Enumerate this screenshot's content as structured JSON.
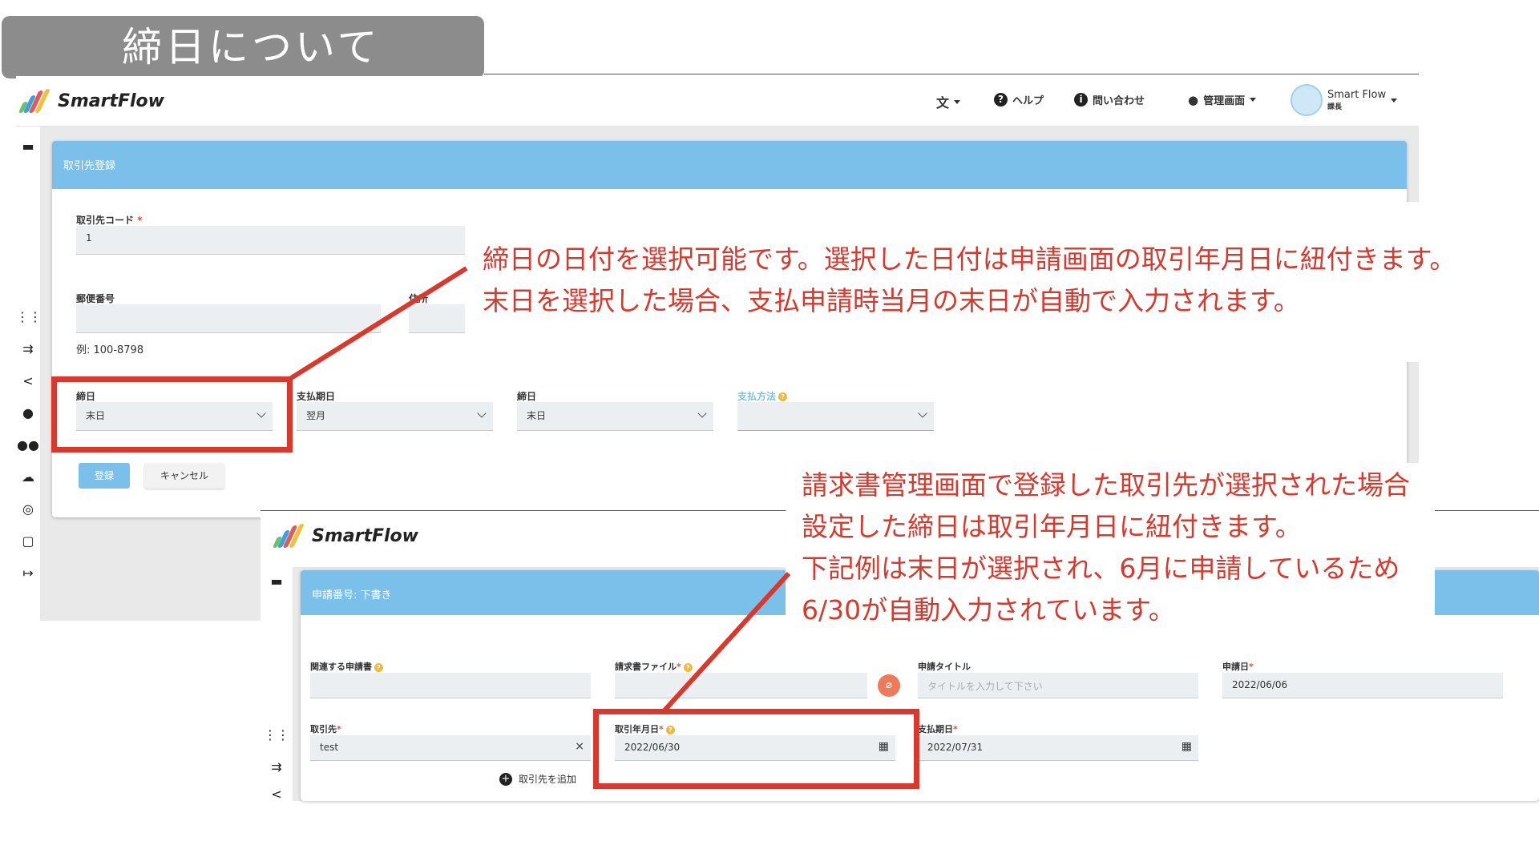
{
  "slide": {
    "title": "締日について"
  },
  "app": {
    "brand": "SmartFlow",
    "header": {
      "translate_icon": "translate-icon",
      "help": "ヘルプ",
      "contact": "問い合わせ",
      "admin": "管理画面",
      "user_name": "Smart Flow",
      "user_role": "課長"
    },
    "colors": {
      "accent": "#7ac0ea",
      "annotation": "#d9382c",
      "help": "#f0b840"
    }
  },
  "vendor_form": {
    "header": "取引先登録",
    "code_label": "取引先コード",
    "code_required": "*",
    "code_value": "1",
    "postal_label": "郵便番号",
    "postal_hint": "例: 100-8798",
    "address_label": "住所",
    "closing_label": "締日",
    "closing_value": "末日",
    "pay_month_label": "支払期日",
    "pay_month_value": "翌月",
    "pay_day_label": "締日",
    "pay_day_value": "末日",
    "pay_method_label": "支払方法",
    "pay_method_value": "",
    "submit": "登録",
    "cancel": "キャンセル"
  },
  "request_form": {
    "header": "申請番号: 下書き",
    "related_label": "関連する申請書",
    "invoice_label": "請求書ファイル",
    "invoice_required": "*",
    "title_label": "申請タイトル",
    "title_placeholder": "タイトルを入力して下さい",
    "date_label": "申請日",
    "date_required": "*",
    "date_value": "2022/06/06",
    "vendor_label": "取引先",
    "vendor_required": "*",
    "vendor_value": "test",
    "vendor_clear": "×",
    "txn_date_label": "取引年月日",
    "txn_date_required": "*",
    "txn_date_value": "2022/06/30",
    "due_label": "支払期日",
    "due_required": "*",
    "due_value": "2022/07/31",
    "add_vendor": "取引先を追加"
  },
  "annotations": {
    "note1_line1": "締日の日付を選択可能です。選択した日付は申請画面の取引年月日に紐付きます。",
    "note1_line2": "末日を選択した場合、支払申請時当月の末日が自動で入力されます。",
    "note2_line1": "請求書管理画面で登録した取引先が選択された場合",
    "note2_line2": "設定した締日は取引年月日に紐付きます。",
    "note2_line3": "下記例は末日が選択され、6月に申請しているため",
    "note2_line4": "6/30が自動入力されています。"
  }
}
